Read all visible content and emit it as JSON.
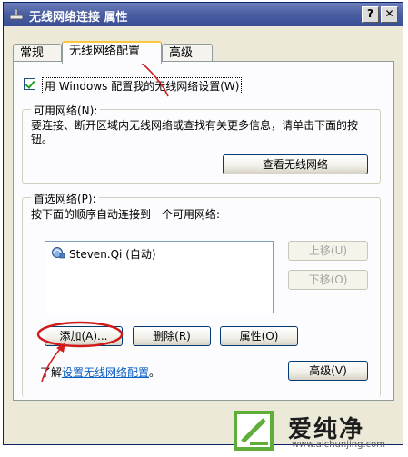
{
  "window": {
    "title": "无线网络连接 属性",
    "help_label": "?",
    "close_label": "✕"
  },
  "tabs": [
    {
      "label": "常规"
    },
    {
      "label": "无线网络配置"
    },
    {
      "label": "高级"
    }
  ],
  "config": {
    "checkbox_label": "用 Windows 配置我的无线网络设置(W)",
    "checked": true
  },
  "available": {
    "heading": "可用网络(N):",
    "description": "要连接、断开区域内无线网络或查找有关更多信息，请单击下面的按钮。",
    "view_button": "查看无线网络"
  },
  "preferred": {
    "heading": "首选网络(P):",
    "description": "按下面的顺序自动连接到一个可用网络:",
    "networks": [
      {
        "label": "Steven.Qi (自动)"
      }
    ],
    "move_up": "上移(U)",
    "move_down": "下移(O)",
    "add": "添加(A)...",
    "remove": "删除(R)",
    "properties": "属性(O)"
  },
  "learn": {
    "prefix": "了解",
    "link": "设置无线网络配置",
    "suffix": "。"
  },
  "advanced_button": "高级(V)",
  "annotation_color": "#d01b1b",
  "watermark": {
    "title": "爱纯净",
    "url": "www.aichunjing.com",
    "accent": "#5fae3a"
  }
}
